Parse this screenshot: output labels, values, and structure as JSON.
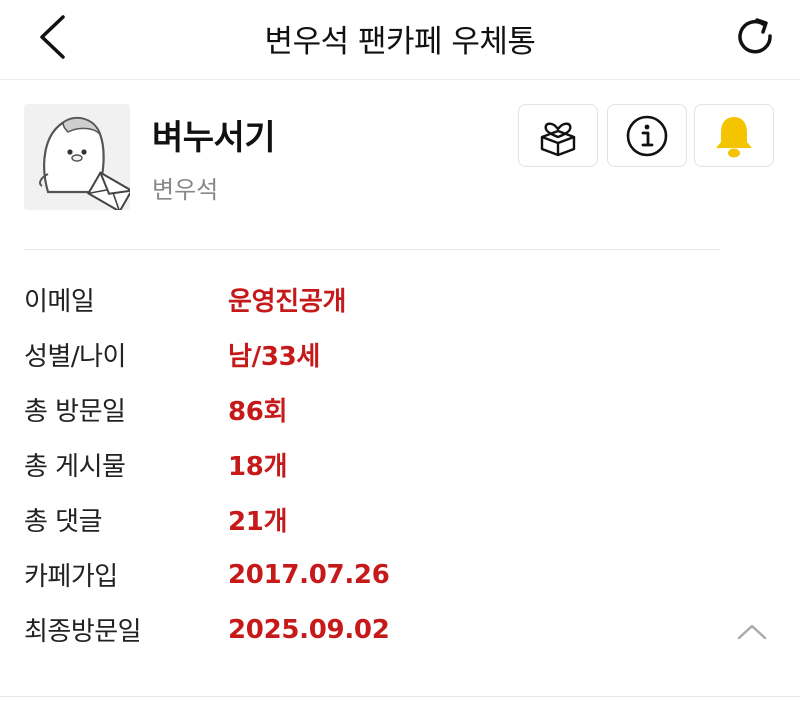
{
  "header": {
    "title": "변우석 팬카페 우체통",
    "back_icon": "chevron-left-icon",
    "refresh_icon": "refresh-icon"
  },
  "profile": {
    "nickname": "벼누서기",
    "username": "변우석",
    "avatar_icon": "penguin-avatar-with-envelope-icon"
  },
  "actions": [
    {
      "icon": "gift-box-icon"
    },
    {
      "icon": "info-icon"
    },
    {
      "icon": "bell-icon",
      "color": "#f5c400"
    }
  ],
  "info_rows": [
    {
      "label": "이메일",
      "value": "운영진공개"
    },
    {
      "label": "성별/나이",
      "value": "남/33세"
    },
    {
      "label": "총 방문일",
      "value": "86회"
    },
    {
      "label": "총 게시물",
      "value": "18개"
    },
    {
      "label": "총 댓글",
      "value": "21개"
    },
    {
      "label": "카페가입",
      "value": "2017.07.26"
    },
    {
      "label": "최종방문일",
      "value": "2025.09.02"
    }
  ],
  "collapse_icon": "chevron-up-icon",
  "colors": {
    "accent_red": "#c61a1a",
    "bell_yellow": "#f5c400",
    "muted_gray": "#888888"
  }
}
